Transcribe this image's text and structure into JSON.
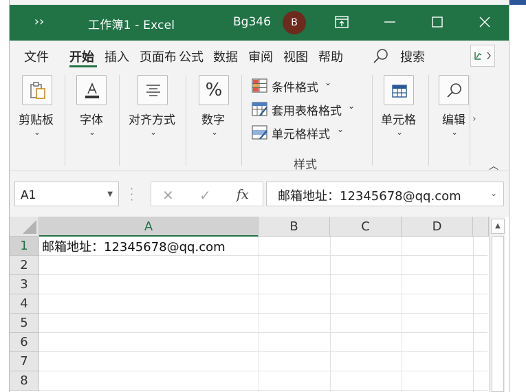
{
  "window": {
    "quick_access_glyph": "››",
    "title": "工作簿1  -  Excel",
    "user_name": "Bg346",
    "user_initial": "B"
  },
  "menu": {
    "tabs": [
      "文件",
      "开始",
      "插入",
      "页面布",
      "公式",
      "数据",
      "审阅",
      "视图",
      "帮助"
    ],
    "active_tab": "开始",
    "search_label": "搜索"
  },
  "ribbon": {
    "clipboard_label": "剪贴板",
    "font_label": "字体",
    "align_label": "对齐方式",
    "number_label": "数字",
    "number_symbol": "%",
    "styles": {
      "conditional_format": "条件格式",
      "table_format": "套用表格格式",
      "cell_style": "单元格样式",
      "group_caption": "样式"
    },
    "cells_label": "单元格",
    "edit_label": "编辑"
  },
  "formula_bar": {
    "name_box": "A1",
    "fx_label": "fx",
    "content": "邮箱地址：12345678@qq.com"
  },
  "sheet": {
    "columns": [
      "A",
      "B",
      "C",
      "D"
    ],
    "rows": [
      "1",
      "2",
      "3",
      "4",
      "5",
      "6",
      "7",
      "8"
    ],
    "cells": {
      "A1": "邮箱地址：12345678@qq.com"
    }
  },
  "colors": {
    "title_bar": "#217346",
    "avatar": "#6e2a1d",
    "accent_blue": "#2b579a"
  }
}
